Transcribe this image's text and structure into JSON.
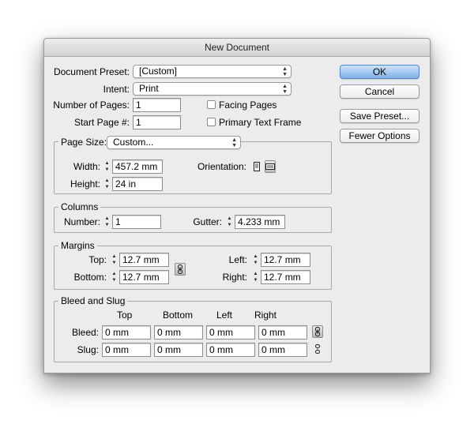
{
  "window": {
    "title": "New Document"
  },
  "preset": {
    "label": "Document Preset:",
    "value": "[Custom]"
  },
  "intent": {
    "label": "Intent:",
    "value": "Print"
  },
  "num_pages": {
    "label": "Number of Pages:",
    "value": "1"
  },
  "start_page": {
    "label": "Start Page #:",
    "value": "1"
  },
  "facing_pages": {
    "label": "Facing Pages",
    "checked": false
  },
  "primary_text_frame": {
    "label": "Primary Text Frame",
    "checked": false
  },
  "page_size": {
    "legend": "Page Size:",
    "value": "Custom...",
    "width_label": "Width:",
    "width": "457.2 mm",
    "height_label": "Height:",
    "height": "24 in",
    "orientation_label": "Orientation:"
  },
  "columns": {
    "legend": "Columns",
    "number_label": "Number:",
    "number": "1",
    "gutter_label": "Gutter:",
    "gutter": "4.233 mm"
  },
  "margins": {
    "legend": "Margins",
    "top_label": "Top:",
    "top": "12.7 mm",
    "bottom_label": "Bottom:",
    "bottom": "12.7 mm",
    "left_label": "Left:",
    "left": "12.7 mm",
    "right_label": "Right:",
    "right": "12.7 mm"
  },
  "bleed_slug": {
    "legend": "Bleed and Slug",
    "headers": [
      "Top",
      "Bottom",
      "Left",
      "Right"
    ],
    "bleed_label": "Bleed:",
    "bleed": [
      "0 mm",
      "0 mm",
      "0 mm",
      "0 mm"
    ],
    "slug_label": "Slug:",
    "slug": [
      "0 mm",
      "0 mm",
      "0 mm",
      "0 mm"
    ]
  },
  "buttons": {
    "ok": "OK",
    "cancel": "Cancel",
    "save_preset": "Save Preset...",
    "fewer_options": "Fewer Options"
  }
}
